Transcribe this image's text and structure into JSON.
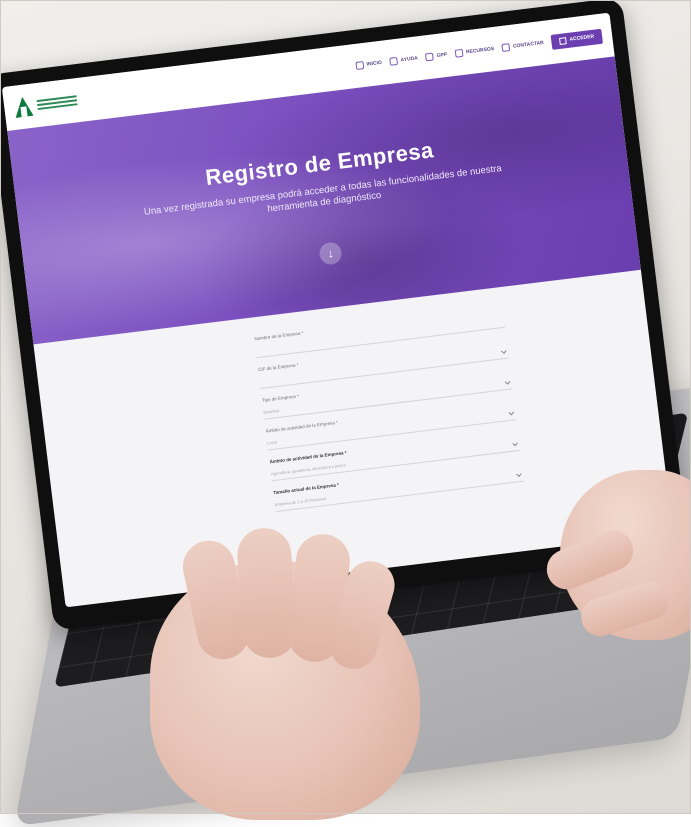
{
  "header": {
    "nav": [
      {
        "label": "INICIO",
        "icon": "home-icon"
      },
      {
        "label": "AYUDA",
        "icon": "help-icon"
      },
      {
        "label": "GPP",
        "icon": "info-icon"
      },
      {
        "label": "RECURSOS",
        "icon": "book-icon"
      },
      {
        "label": "CONTACTAR",
        "icon": "mail-icon"
      }
    ],
    "access_label": "ACCEDER"
  },
  "hero": {
    "title": "Registro de Empresa",
    "subtitle": "Una vez registrada su empresa podrá acceder a todas las funcionalidades de nuestra herramienta de diagnóstico"
  },
  "form": {
    "fields": [
      {
        "label": "Nombre de la Empresa *",
        "value": ""
      },
      {
        "label": "CIF de la Empresa *",
        "value": ""
      },
      {
        "label": "Tipo de Empresa *",
        "value": "Empresa"
      },
      {
        "label": "Ámbito de actividad de la Empresa *",
        "value": "Local"
      },
      {
        "label": "Ámbito de actividad de la Empresa *",
        "value": "Agricultura, ganadería, silvicultura y pesca"
      },
      {
        "label": "Tamaño actual de la Empresa *",
        "value": "Empresa de 1 a 10 Personas"
      }
    ]
  },
  "colors": {
    "brand_purple": "#6b3fb0",
    "logo_green": "#0a7a3d"
  }
}
